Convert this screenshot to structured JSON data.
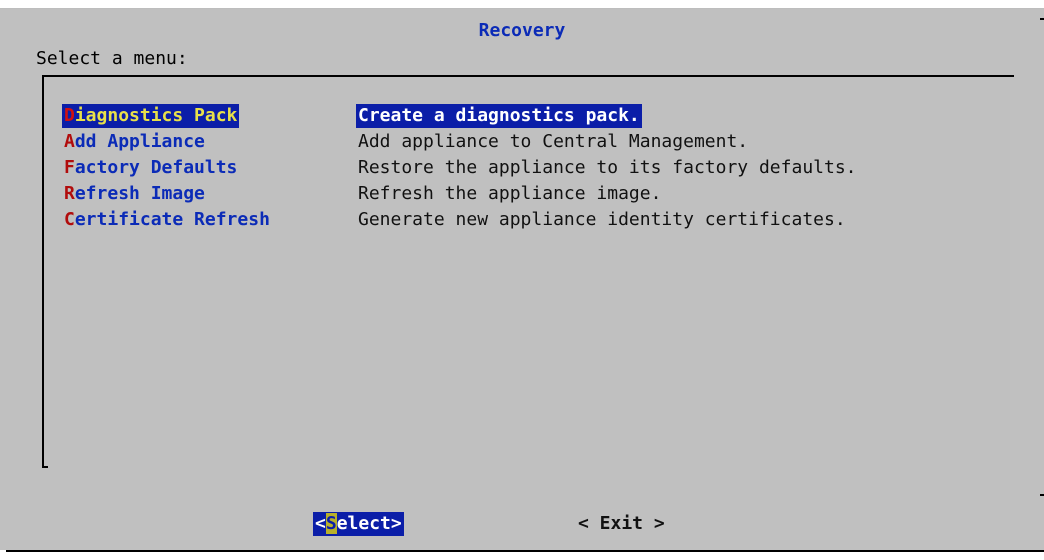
{
  "dialog": {
    "title": "Recovery",
    "prompt": "Select a menu:"
  },
  "menu": {
    "items": [
      {
        "hotkey": "D",
        "rest": "iagnostics Pack",
        "description": "Create a diagnostics pack.",
        "selected": true
      },
      {
        "hotkey": "A",
        "rest": "dd Appliance",
        "description": "Add appliance to Central Management.",
        "selected": false
      },
      {
        "hotkey": "F",
        "rest": "actory Defaults",
        "description": "Restore the appliance to its factory defaults.",
        "selected": false
      },
      {
        "hotkey": "R",
        "rest": "efresh Image",
        "description": "Refresh the appliance image.",
        "selected": false
      },
      {
        "hotkey": "C",
        "rest": "ertificate Refresh",
        "description": "Generate new appliance identity certificates.",
        "selected": false
      }
    ]
  },
  "buttons": {
    "select": {
      "open": "<",
      "hotkey": "S",
      "rest": "elect",
      "close": ">"
    },
    "exit": {
      "label": "< Exit >"
    }
  },
  "colors": {
    "background": "#c0c0c0",
    "title": "#0b2bb7",
    "selection_bg": "#0b1ea8",
    "hotkey": "#b10c0c",
    "selected_tag_text": "#e8e04a"
  }
}
